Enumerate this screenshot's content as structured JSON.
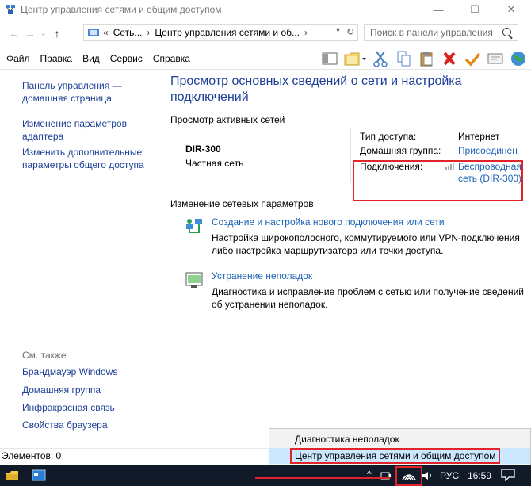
{
  "window": {
    "title": "Центр управления сетями и общим доступом",
    "minimize": "—",
    "maximize": "☐",
    "close": "✕"
  },
  "nav": {
    "back": "←",
    "forward": "→",
    "dropdown": "⌄",
    "up": "↑",
    "breadcrumb": [
      "«",
      "Сеть...",
      "›",
      "Центр управления сетями и об...",
      "›"
    ],
    "search_placeholder": "Поиск в панели управления"
  },
  "menu": [
    "Файл",
    "Правка",
    "Вид",
    "Сервис",
    "Справка"
  ],
  "toolbar_icons": [
    "pane-icon",
    "folder-icon",
    "cut-icon",
    "copy-icon",
    "paste-icon",
    "delete-icon",
    "check-icon",
    "mail-icon",
    "globe-icon"
  ],
  "left": {
    "links": [
      "Панель управления — домашняя страница",
      "Изменение параметров адаптера",
      "Изменить дополнительные параметры общего доступа"
    ],
    "see_also": "См. также",
    "see_also_links": [
      "Брандмауэр Windows",
      "Домашняя группа",
      "Инфракрасная связь",
      "Свойства браузера"
    ]
  },
  "main": {
    "heading": "Просмотр основных сведений о сети и настройка подключений",
    "active_networks": "Просмотр активных сетей",
    "network": {
      "name": "DIR-300",
      "type": "Частная сеть"
    },
    "access_type_label": "Тип доступа:",
    "access_type_value": "Интернет",
    "homegroup_label": "Домашняя группа:",
    "homegroup_value": "Присоединен",
    "connections_label": "Подключения:",
    "connection_value_1": "Беспроводная",
    "connection_value_2": "сеть (DIR-300)",
    "change_settings": "Изменение сетевых параметров",
    "tasks": [
      {
        "title": "Создание и настройка нового подключения или сети",
        "desc": "Настройка широкополосного, коммутируемого или VPN-подключения либо настройка маршрутизатора или точки доступа."
      },
      {
        "title": "Устранение неполадок",
        "desc": "Диагностика и исправление проблем с сетью или получение сведений об устранении неполадок."
      }
    ]
  },
  "status": "Элементов: 0",
  "context_menu": [
    "Диагностика неполадок",
    "Центр управления сетями и общим доступом"
  ],
  "taskbar": {
    "lang": "РУС",
    "time": "16:59",
    "chevron": "^"
  },
  "colors": {
    "heading": "#1e3f99",
    "link": "#1c63b7",
    "highlight_box": "#e0242a",
    "taskbar": "#101a29"
  }
}
